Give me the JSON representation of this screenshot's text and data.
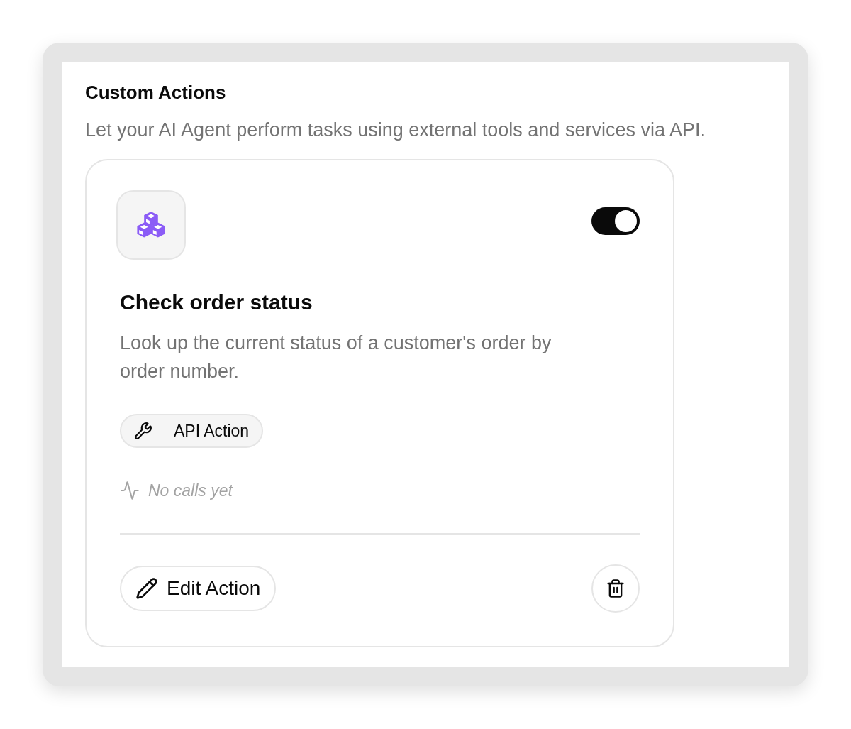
{
  "section": {
    "title": "Custom Actions",
    "subtitle": "Let your AI Agent perform tasks using external tools and services via API."
  },
  "action_card": {
    "enabled": true,
    "title": "Check order status",
    "description": "Look up the current status of a customer's order by order number.",
    "badge": {
      "label": "API Action"
    },
    "usage": "No calls yet",
    "buttons": [
      {
        "kind": "edit",
        "label": "Edit Action"
      },
      {
        "kind": "delete"
      }
    ]
  }
}
